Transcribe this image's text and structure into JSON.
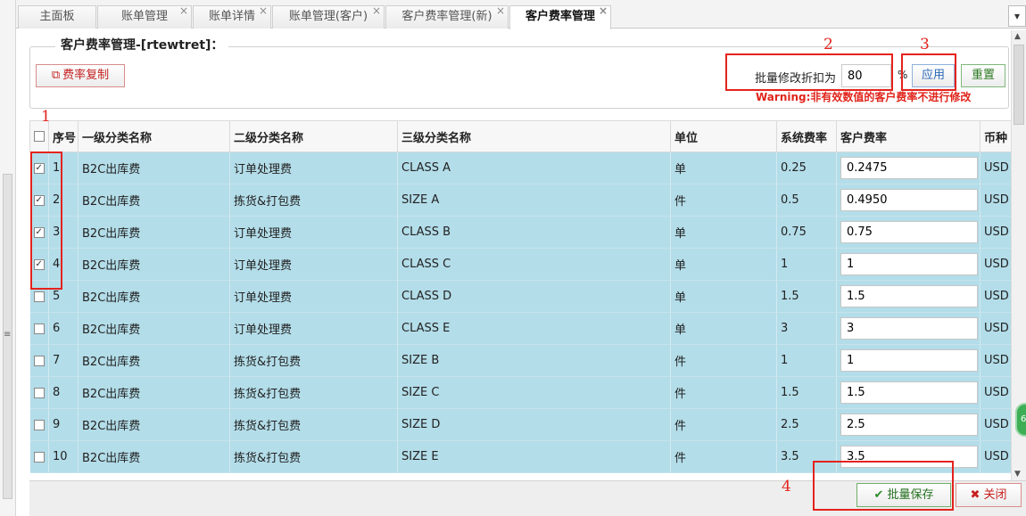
{
  "tabs": [
    {
      "label": "主面板",
      "closable": false
    },
    {
      "label": "账单管理",
      "closable": true
    },
    {
      "label": "账单详情",
      "closable": true
    },
    {
      "label": "账单管理(客户)",
      "closable": true
    },
    {
      "label": "客户费率管理(新)",
      "closable": true
    },
    {
      "label": "客户费率管理",
      "closable": true,
      "active": true
    }
  ],
  "tab_close_glyph": "×",
  "tab_menu_glyph": "▾",
  "panel": {
    "legend": "客户费率管理-[rtewtret]：",
    "copy_button": "费率复制",
    "discount_label": "批量修改折扣为",
    "discount_value": "80",
    "percent_sign": "%",
    "apply_button": "应用",
    "reset_button": "重置",
    "warning": "Warning:非有效数值的客户费率不进行修改"
  },
  "table": {
    "columns": [
      "序号",
      "一级分类名称",
      "二级分类名称",
      "三级分类名称",
      "单位",
      "系统费率",
      "客户费率",
      "币种"
    ],
    "rows": [
      {
        "checked": true,
        "no": "1",
        "cat1": "B2C出库费",
        "cat2": "订单处理费",
        "cat3": "CLASS A",
        "unit": "单",
        "sys_rate": "0.25",
        "cust_rate": "0.2475",
        "currency": "USD"
      },
      {
        "checked": true,
        "no": "2",
        "cat1": "B2C出库费",
        "cat2": "拣货&打包费",
        "cat3": "SIZE A",
        "unit": "件",
        "sys_rate": "0.5",
        "cust_rate": "0.4950",
        "currency": "USD"
      },
      {
        "checked": true,
        "no": "3",
        "cat1": "B2C出库费",
        "cat2": "订单处理费",
        "cat3": "CLASS B",
        "unit": "单",
        "sys_rate": "0.75",
        "cust_rate": "0.75",
        "currency": "USD"
      },
      {
        "checked": true,
        "no": "4",
        "cat1": "B2C出库费",
        "cat2": "订单处理费",
        "cat3": "CLASS C",
        "unit": "单",
        "sys_rate": "1",
        "cust_rate": "1",
        "currency": "USD"
      },
      {
        "checked": false,
        "no": "5",
        "cat1": "B2C出库费",
        "cat2": "订单处理费",
        "cat3": "CLASS D",
        "unit": "单",
        "sys_rate": "1.5",
        "cust_rate": "1.5",
        "currency": "USD"
      },
      {
        "checked": false,
        "no": "6",
        "cat1": "B2C出库费",
        "cat2": "订单处理费",
        "cat3": "CLASS E",
        "unit": "单",
        "sys_rate": "3",
        "cust_rate": "3",
        "currency": "USD"
      },
      {
        "checked": false,
        "no": "7",
        "cat1": "B2C出库费",
        "cat2": "拣货&打包费",
        "cat3": "SIZE B",
        "unit": "件",
        "sys_rate": "1",
        "cust_rate": "1",
        "currency": "USD"
      },
      {
        "checked": false,
        "no": "8",
        "cat1": "B2C出库费",
        "cat2": "拣货&打包费",
        "cat3": "SIZE C",
        "unit": "件",
        "sys_rate": "1.5",
        "cust_rate": "1.5",
        "currency": "USD"
      },
      {
        "checked": false,
        "no": "9",
        "cat1": "B2C出库费",
        "cat2": "拣货&打包费",
        "cat3": "SIZE D",
        "unit": "件",
        "sys_rate": "2.5",
        "cust_rate": "2.5",
        "currency": "USD"
      },
      {
        "checked": false,
        "no": "10",
        "cat1": "B2C出库费",
        "cat2": "拣货&打包费",
        "cat3": "SIZE E",
        "unit": "件",
        "sys_rate": "3.5",
        "cust_rate": "3.5",
        "currency": "USD"
      }
    ]
  },
  "footer": {
    "save_button": "批量保存",
    "close_button": "关闭"
  },
  "annotations": [
    "1",
    "2",
    "3",
    "4"
  ],
  "icons": {
    "copy": "copy-icon",
    "save": "check-icon",
    "close": "x-icon",
    "check_glyph": "✓",
    "save_glyph": "✔",
    "close_glyph": "✖",
    "copy_glyph": "⧉"
  },
  "badge_text": "6",
  "colors": {
    "row_bg": "#b3dde9",
    "annotation": "#e4231d",
    "warning": "#e0241b",
    "apply": "#2a67b8",
    "reset": "#2d7a23"
  }
}
